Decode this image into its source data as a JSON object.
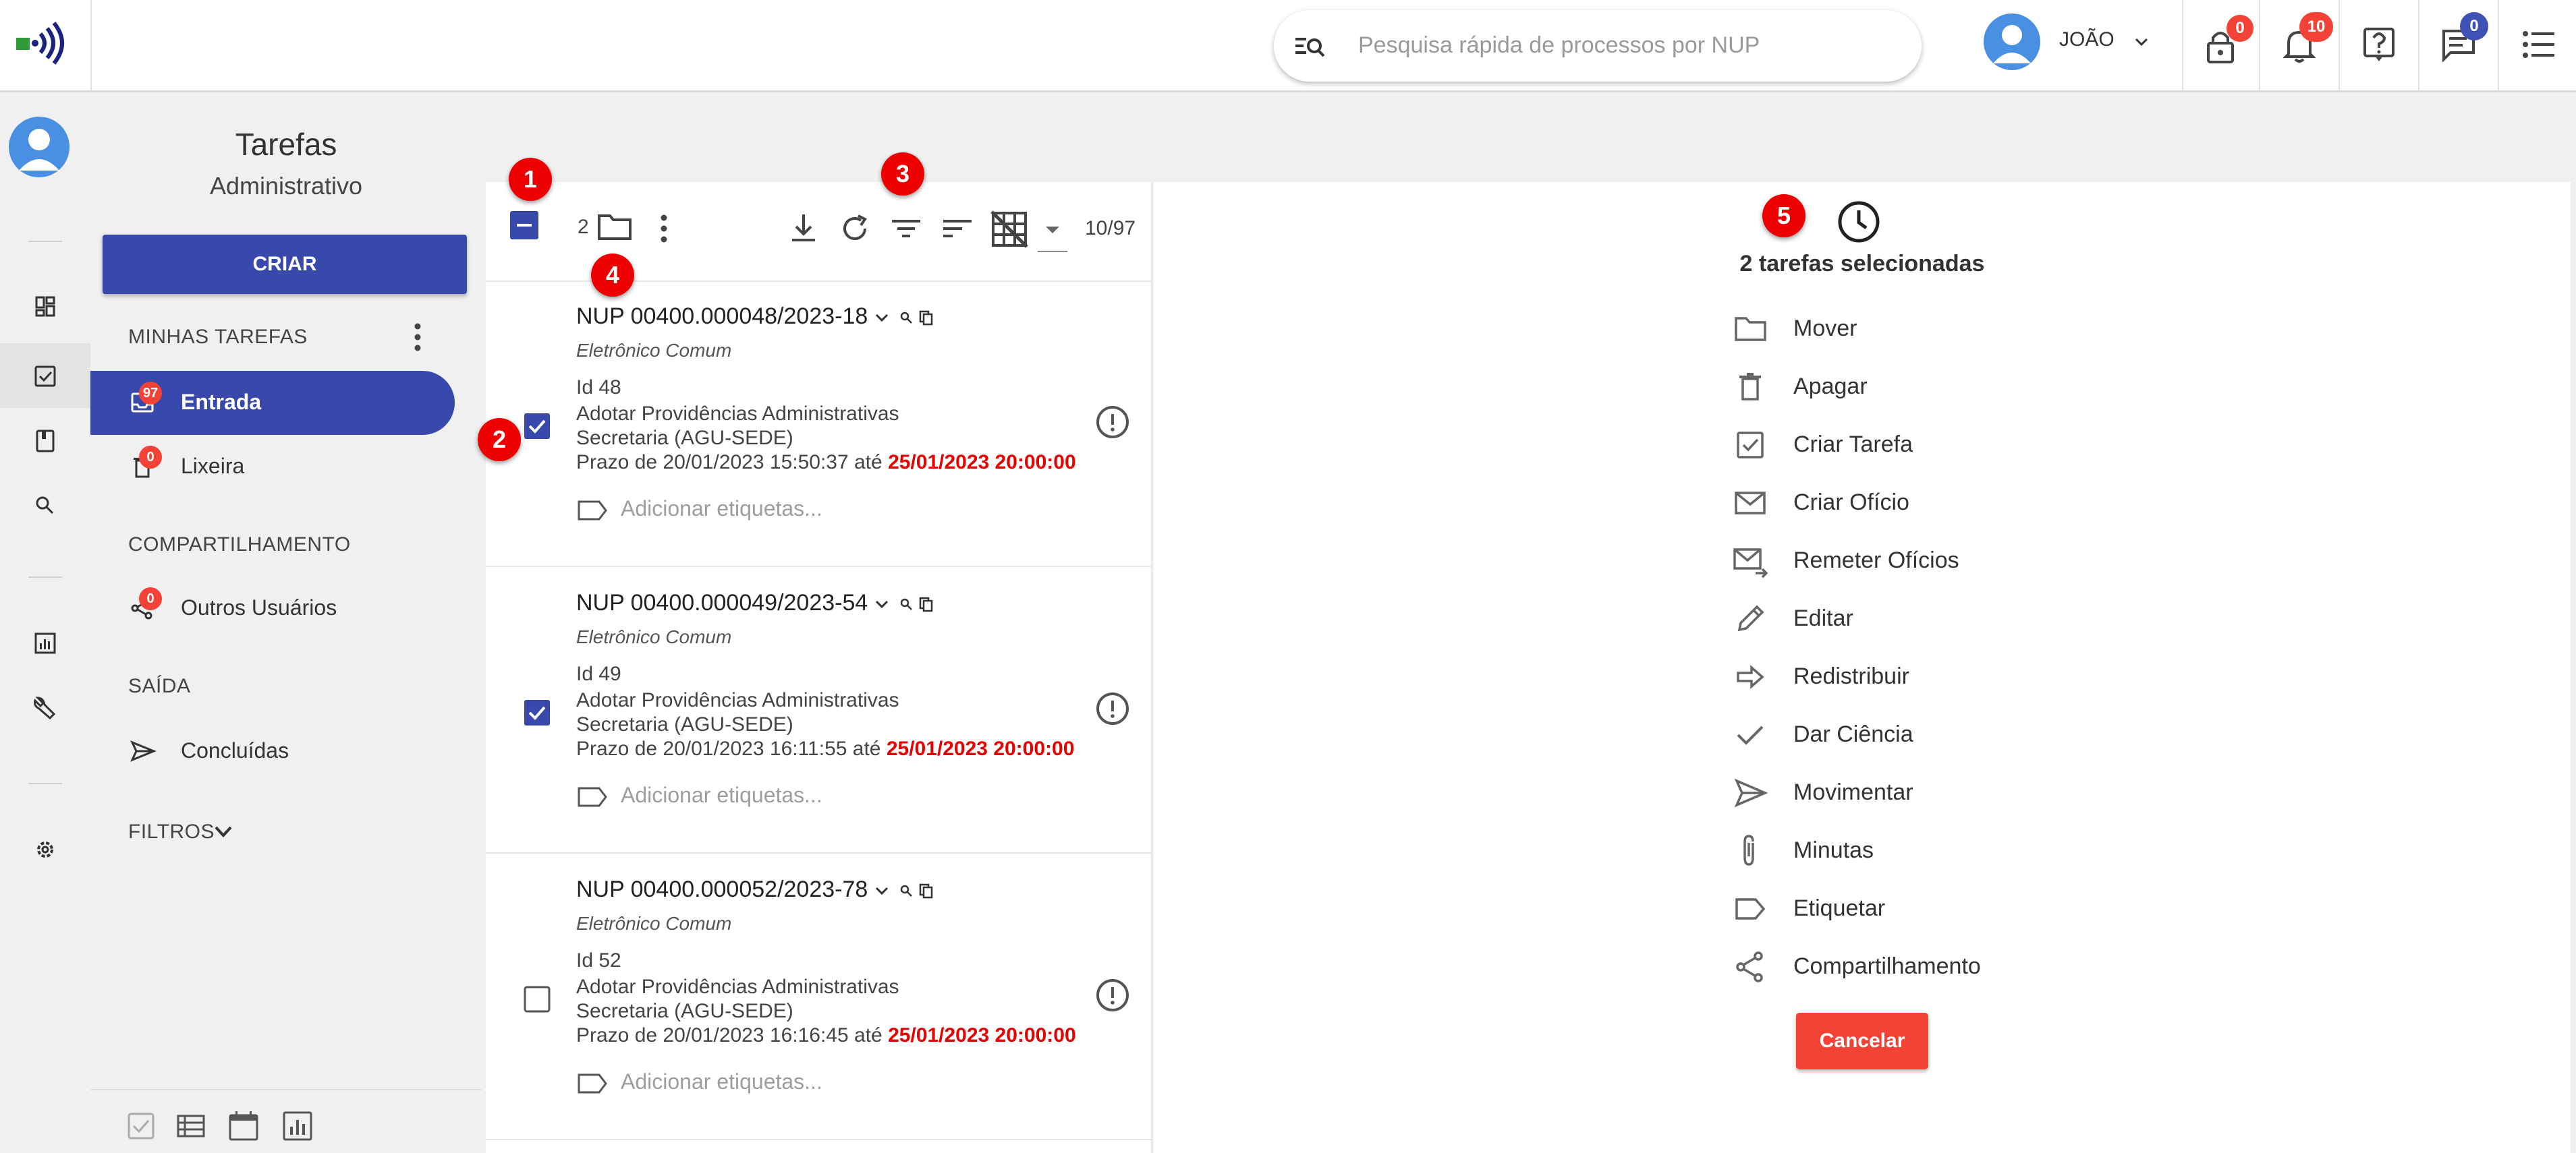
{
  "topbar": {
    "search_placeholder": "Pesquisa rápida de processos por NUP",
    "user_name": "JOÃO",
    "lock_count": "0",
    "notifications_count": "10",
    "messages_count": "0"
  },
  "sidebar": {
    "title": "Tarefas",
    "subtitle": "Administrativo",
    "create_label": "CRIAR",
    "section_minhas": "MINHAS TAREFAS",
    "entrada_label": "Entrada",
    "entrada_count": "97",
    "lixeira_label": "Lixeira",
    "lixeira_count": "0",
    "section_compartilhamento": "COMPARTILHAMENTO",
    "outros_label": "Outros Usuários",
    "outros_count": "0",
    "section_saida": "SAÍDA",
    "concluidas_label": "Concluídas",
    "filtros_label": "FILTROS"
  },
  "list": {
    "selected_count": "2",
    "page_info": "10/97",
    "items": [
      {
        "nup": "NUP 00400.000048/2023-18",
        "tipo": "Eletrônico Comum",
        "id_label": "Id 48",
        "desc1": "Adotar Providências Administrativas",
        "desc2": "Secretaria (AGU-SEDE)",
        "prazo_start": "Prazo de 20/01/2023 15:50:37 até",
        "prazo_end": "25/01/2023 20:00:00",
        "tag_placeholder": "Adicionar etiquetas...",
        "checked": true
      },
      {
        "nup": "NUP 00400.000049/2023-54",
        "tipo": "Eletrônico Comum",
        "id_label": "Id 49",
        "desc1": "Adotar Providências Administrativas",
        "desc2": "Secretaria (AGU-SEDE)",
        "prazo_start": "Prazo de 20/01/2023 16:11:55 até",
        "prazo_end": "25/01/2023 20:00:00",
        "tag_placeholder": "Adicionar etiquetas...",
        "checked": true
      },
      {
        "nup": "NUP 00400.000052/2023-78",
        "tipo": "Eletrônico Comum",
        "id_label": "Id 52",
        "desc1": "Adotar Providências Administrativas",
        "desc2": "Secretaria (AGU-SEDE)",
        "prazo_start": "Prazo de 20/01/2023 16:16:45 até",
        "prazo_end": "25/01/2023 20:00:00",
        "tag_placeholder": "Adicionar etiquetas...",
        "checked": false
      }
    ]
  },
  "panel": {
    "selected_text": "2 tarefas selecionadas",
    "actions": [
      {
        "label": "Mover",
        "icon": "folder-icon"
      },
      {
        "label": "Apagar",
        "icon": "trash-icon"
      },
      {
        "label": "Criar Tarefa",
        "icon": "checkbox-icon"
      },
      {
        "label": "Criar Ofício",
        "icon": "mail-icon"
      },
      {
        "label": "Remeter Ofícios",
        "icon": "mail-send-icon"
      },
      {
        "label": "Editar",
        "icon": "pencil-icon"
      },
      {
        "label": "Redistribuir",
        "icon": "arrow-right-icon"
      },
      {
        "label": "Dar Ciência",
        "icon": "check-icon"
      },
      {
        "label": "Movimentar",
        "icon": "send-icon"
      },
      {
        "label": "Minutas",
        "icon": "paperclip-icon"
      },
      {
        "label": "Etiquetar",
        "icon": "label-icon"
      },
      {
        "label": "Compartilhamento",
        "icon": "share-icon"
      }
    ],
    "cancel_label": "Cancelar"
  },
  "markers": [
    "1",
    "2",
    "3",
    "4",
    "5"
  ],
  "colors": {
    "primary": "#3949ab",
    "danger": "#f44336",
    "deadline": "#e60000"
  }
}
